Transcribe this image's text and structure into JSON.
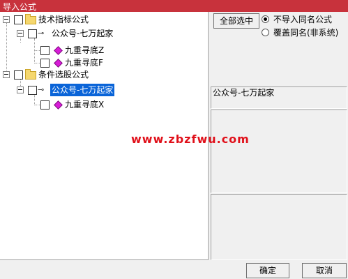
{
  "window": {
    "title": "导入公式"
  },
  "tree": {
    "group1": {
      "label": "技术指标公式"
    },
    "group1_child": {
      "label": "公众号-七万起家"
    },
    "group1_leaf1": {
      "label": "九重寻底Z"
    },
    "group1_leaf2": {
      "label": "九重寻底F"
    },
    "group2": {
      "label": "条件选股公式"
    },
    "group2_child": {
      "label": "公众号-七万起家"
    },
    "group2_leaf1": {
      "label": "九重寻底X"
    }
  },
  "options": {
    "select_all_label": "全部选中",
    "radio1_label": "不导入同名公式",
    "radio1_checked": true,
    "radio2_label": "覆盖同名(非系统)",
    "radio2_checked": false
  },
  "info": {
    "selected_name": "公众号-七万起家"
  },
  "watermark": {
    "text": "www.zbzfwu.com"
  },
  "footer": {
    "ok_label": "确定",
    "cancel_label": "取消"
  },
  "colors": {
    "title_bar": "#c8323c",
    "selection": "#0a64d8",
    "watermark": "#e0101a"
  }
}
